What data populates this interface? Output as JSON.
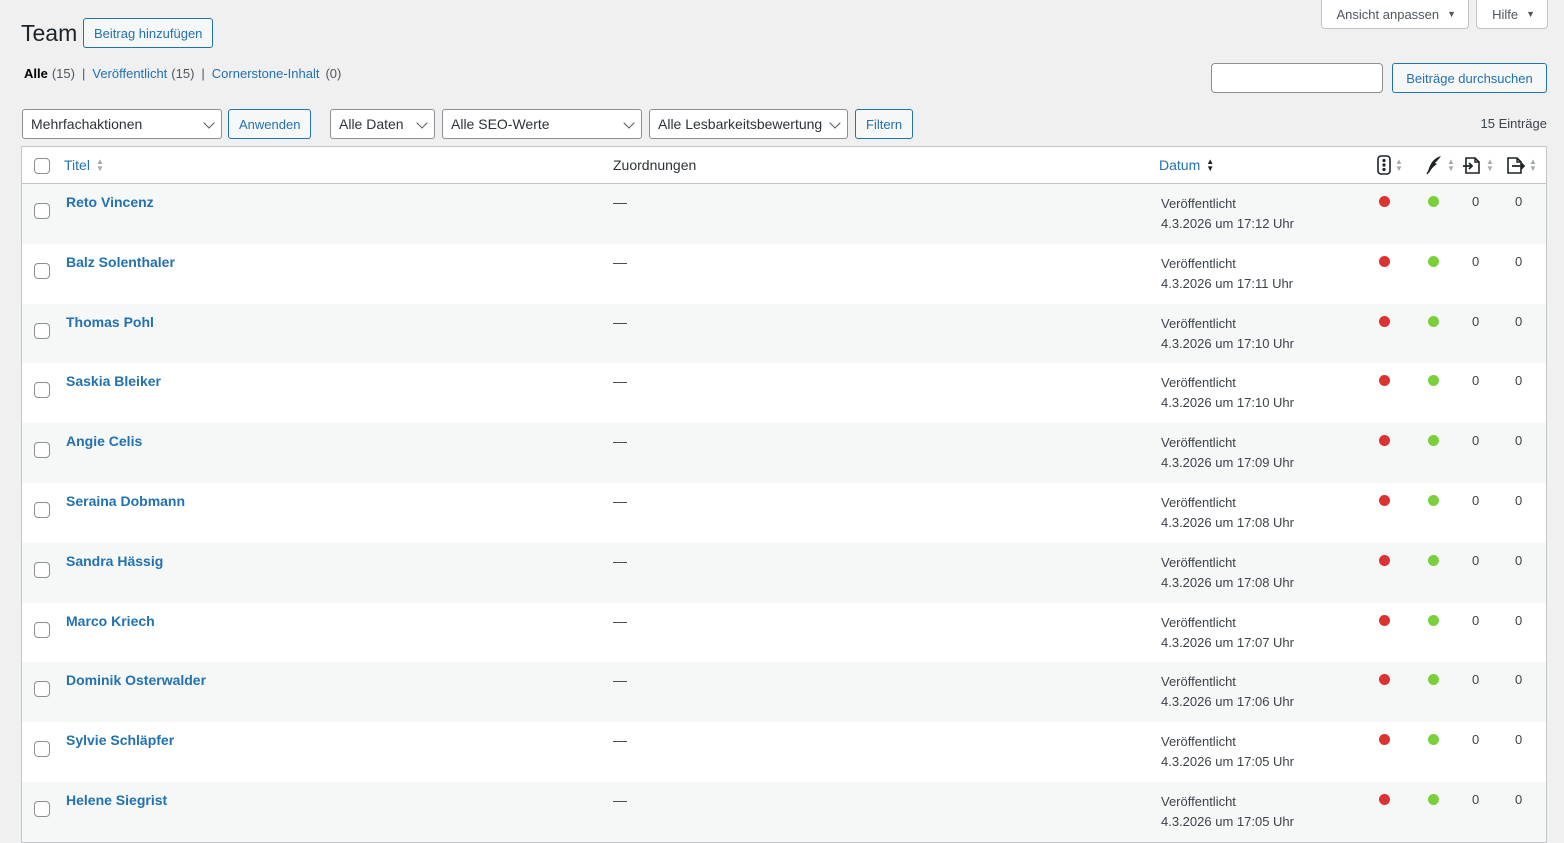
{
  "screen_meta": {
    "screen_options": "Ansicht anpassen",
    "help": "Hilfe"
  },
  "header": {
    "title": "Team",
    "add_new": "Beitrag hinzufügen"
  },
  "views": {
    "all_label": "Alle",
    "all_count": "(15)",
    "published_label": "Veröffentlicht",
    "published_count": "(15)",
    "cornerstone_label": "Cornerstone-Inhalt",
    "cornerstone_count": "(0)",
    "separator": "|"
  },
  "search": {
    "button": "Beiträge durchsuchen",
    "value": ""
  },
  "tablenav": {
    "bulk_actions": "Mehrfachaktionen",
    "apply": "Anwenden",
    "dates": "Alle Daten",
    "seo": "Alle SEO-Werte",
    "readability": "Alle Lesbarkeitsbewertungen",
    "filter": "Filtern",
    "items_count": "15 Einträge"
  },
  "table": {
    "columns": {
      "title": "Titel",
      "assignments": "Zuordnungen",
      "date": "Datum"
    },
    "rows": [
      {
        "title": "Reto Vincenz",
        "assignments": "—",
        "status": "Veröffentlicht",
        "date": "4.3.2026 um 17:12 Uhr",
        "links_out": "0",
        "links_in": "0"
      },
      {
        "title": "Balz Solenthaler",
        "assignments": "—",
        "status": "Veröffentlicht",
        "date": "4.3.2026 um 17:11 Uhr",
        "links_out": "0",
        "links_in": "0"
      },
      {
        "title": "Thomas Pohl",
        "assignments": "—",
        "status": "Veröffentlicht",
        "date": "4.3.2026 um 17:10 Uhr",
        "links_out": "0",
        "links_in": "0"
      },
      {
        "title": "Saskia Bleiker",
        "assignments": "—",
        "status": "Veröffentlicht",
        "date": "4.3.2026 um 17:10 Uhr",
        "links_out": "0",
        "links_in": "0"
      },
      {
        "title": "Angie Celis",
        "assignments": "—",
        "status": "Veröffentlicht",
        "date": "4.3.2026 um 17:09 Uhr",
        "links_out": "0",
        "links_in": "0"
      },
      {
        "title": "Seraina Dobmann",
        "assignments": "—",
        "status": "Veröffentlicht",
        "date": "4.3.2026 um 17:08 Uhr",
        "links_out": "0",
        "links_in": "0"
      },
      {
        "title": "Sandra Hässig",
        "assignments": "—",
        "status": "Veröffentlicht",
        "date": "4.3.2026 um 17:08 Uhr",
        "links_out": "0",
        "links_in": "0"
      },
      {
        "title": "Marco Kriech",
        "assignments": "—",
        "status": "Veröffentlicht",
        "date": "4.3.2026 um 17:07 Uhr",
        "links_out": "0",
        "links_in": "0"
      },
      {
        "title": "Dominik Osterwalder",
        "assignments": "—",
        "status": "Veröffentlicht",
        "date": "4.3.2026 um 17:06 Uhr",
        "links_out": "0",
        "links_in": "0"
      },
      {
        "title": "Sylvie Schläpfer",
        "assignments": "—",
        "status": "Veröffentlicht",
        "date": "4.3.2026 um 17:05 Uhr",
        "links_out": "0",
        "links_in": "0"
      },
      {
        "title": "Helene Siegrist",
        "assignments": "—",
        "status": "Veröffentlicht",
        "date": "4.3.2026 um 17:05 Uhr",
        "links_out": "0",
        "links_in": "0"
      }
    ]
  },
  "colors": {
    "seo_bad": "#dc3232",
    "readability_good": "#7ad03a",
    "link": "#2271b1"
  },
  "icons": {
    "seo_column": "traffic-light-icon",
    "readability_column": "quill-icon",
    "outgoing_links_column": "outgoing-links-icon",
    "incoming_links_column": "incoming-links-icon"
  }
}
